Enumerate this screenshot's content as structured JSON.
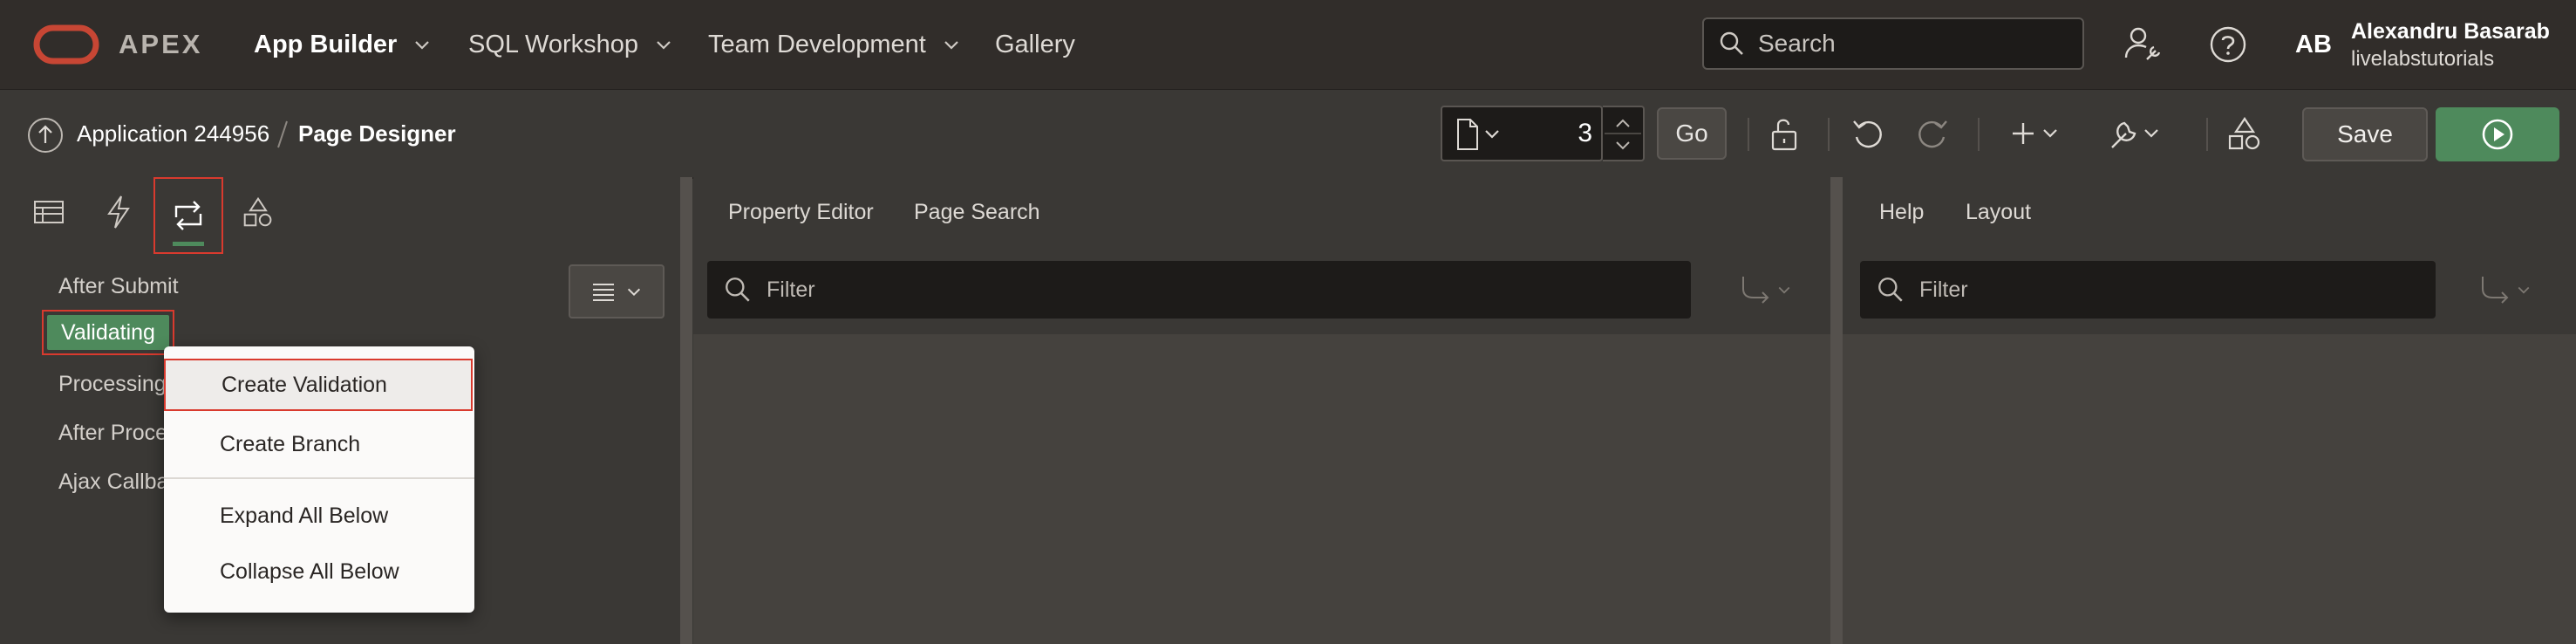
{
  "header": {
    "brand": "APEX",
    "nav": [
      {
        "label": "App Builder"
      },
      {
        "label": "SQL Workshop"
      },
      {
        "label": "Team Development"
      },
      {
        "label": "Gallery"
      }
    ],
    "search_placeholder": "Search",
    "user": {
      "initials": "AB",
      "name": "Alexandru Basarab",
      "workspace": "livelabstutorials"
    }
  },
  "toolbar": {
    "breadcrumb_app": "Application 244956",
    "breadcrumb_page": "Page Designer",
    "page_number": "3",
    "go_label": "Go",
    "save_label": "Save"
  },
  "left_panel": {
    "tree": [
      "After Submit",
      "Validating",
      "Processing",
      "After Proce",
      "Ajax Callba"
    ],
    "selected": "Validating"
  },
  "context_menu": {
    "items": [
      "Create Validation",
      "Create Branch",
      "Expand All Below",
      "Collapse All Below"
    ]
  },
  "center_panel": {
    "tabs": [
      "Property Editor",
      "Page Search"
    ],
    "filter_placeholder": "Filter"
  },
  "right_panel": {
    "tabs": [
      "Help",
      "Layout"
    ],
    "filter_placeholder": "Filter"
  },
  "colors": {
    "accent_green": "#4e8a5c",
    "highlight_red": "#d93a2e",
    "header_bg": "#312d2a",
    "oracle_red": "#c74634"
  }
}
